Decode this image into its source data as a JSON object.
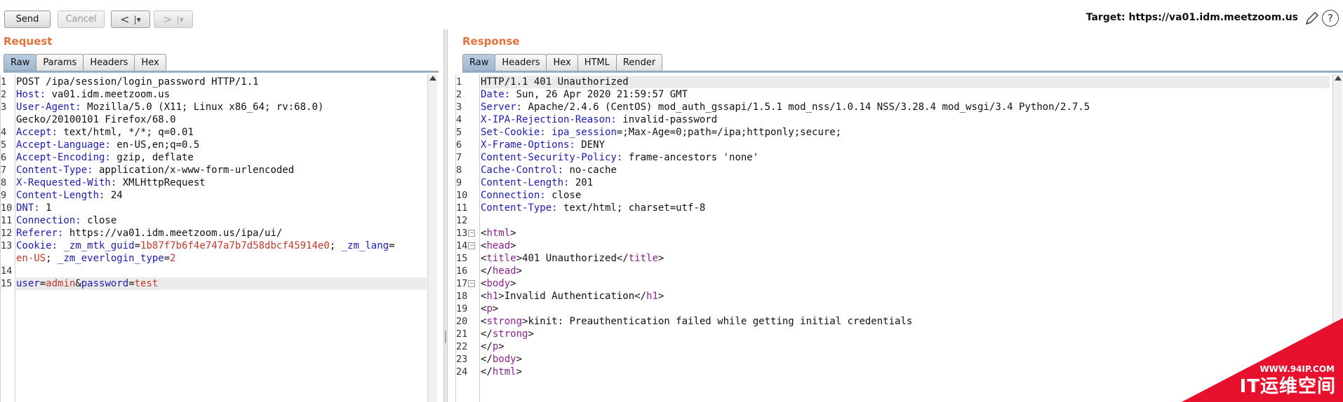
{
  "toolbar": {
    "send_label": "Send",
    "cancel_label": "Cancel",
    "back_label": "<",
    "forward_label": ">",
    "dropdown_glyph": "|▾",
    "target_text": "Target: https://va01.idm.meetzoom.us",
    "edit_icon": "pencil-icon",
    "help_label": "?"
  },
  "request": {
    "title": "Request",
    "tabs": [
      {
        "label": "Raw",
        "active": true
      },
      {
        "label": "Params",
        "active": false
      },
      {
        "label": "Headers",
        "active": false
      },
      {
        "label": "Hex",
        "active": false
      }
    ],
    "line_numbers": [
      "1",
      "2",
      "3",
      "",
      "4",
      "5",
      "6",
      "7",
      "8",
      "9",
      "10",
      "11",
      "12",
      "13",
      "",
      "14",
      "15"
    ],
    "lines": [
      {
        "type": "plain",
        "text": "POST /ipa/session/login_password HTTP/1.1"
      },
      {
        "type": "header",
        "name": "Host:",
        "value": " va01.idm.meetzoom.us"
      },
      {
        "type": "header",
        "name": "User-Agent:",
        "value": " Mozilla/5.0 (X11; Linux x86_64; rv:68.0)"
      },
      {
        "type": "plain",
        "text": "Gecko/20100101 Firefox/68.0"
      },
      {
        "type": "header",
        "name": "Accept:",
        "value": " text/html, */*; q=0.01"
      },
      {
        "type": "header",
        "name": "Accept-Language:",
        "value": " en-US,en;q=0.5"
      },
      {
        "type": "header",
        "name": "Accept-Encoding:",
        "value": " gzip, deflate"
      },
      {
        "type": "header",
        "name": "Content-Type:",
        "value": " application/x-www-form-urlencoded"
      },
      {
        "type": "header",
        "name": "X-Requested-With:",
        "value": " XMLHttpRequest"
      },
      {
        "type": "header",
        "name": "Content-Length:",
        "value": " 24"
      },
      {
        "type": "header",
        "name": "DNT:",
        "value": " 1"
      },
      {
        "type": "header",
        "name": "Connection:",
        "value": " close"
      },
      {
        "type": "header",
        "name": "Referer:",
        "value": " https://va01.idm.meetzoom.us/ipa/ui/"
      },
      {
        "type": "cookie1",
        "name": "Cookie:",
        "parts": [
          " ",
          "_zm_mtk_guid",
          "=",
          "1b87f7b6f4e747a7b7d58dbcf45914e0",
          "; ",
          "_zm_lang",
          "="
        ]
      },
      {
        "type": "cookie2",
        "parts": [
          "en-US",
          "; ",
          "_zm_everlogin_type",
          "=",
          "2"
        ]
      },
      {
        "type": "plain",
        "text": ""
      },
      {
        "type": "body",
        "parts": [
          "user",
          "=",
          "admin",
          "&",
          "password",
          "=",
          "test"
        ]
      }
    ]
  },
  "response": {
    "title": "Response",
    "tabs": [
      {
        "label": "Raw",
        "active": true
      },
      {
        "label": "Headers",
        "active": false
      },
      {
        "label": "Hex",
        "active": false
      },
      {
        "label": "HTML",
        "active": false
      },
      {
        "label": "Render",
        "active": false
      }
    ],
    "line_numbers": [
      "1",
      "2",
      "3",
      "4",
      "5",
      "6",
      "7",
      "8",
      "9",
      "10",
      "11",
      "12",
      "13",
      "14",
      "15",
      "16",
      "17",
      "18",
      "19",
      "20",
      "21",
      "22",
      "23",
      "24"
    ],
    "fold_lines": [
      "13",
      "14",
      "17"
    ],
    "lines": [
      {
        "type": "plain",
        "text": "HTTP/1.1 401 Unauthorized"
      },
      {
        "type": "header",
        "name": "Date:",
        "value": " Sun, 26 Apr 2020 21:59:57 GMT"
      },
      {
        "type": "header",
        "name": "Server:",
        "value": " Apache/2.4.6 (CentOS) mod_auth_gssapi/1.5.1 mod_nss/1.0.14 NSS/3.28.4 mod_wsgi/3.4 Python/2.7.5"
      },
      {
        "type": "header",
        "name": "X-IPA-Rejection-Reason:",
        "value": " invalid-password"
      },
      {
        "type": "setcookie",
        "name": "Set-Cookie:",
        "parts": [
          " ",
          "ipa_session",
          "=;Max-Age=0;path=/ipa;httponly;secure;"
        ]
      },
      {
        "type": "header",
        "name": "X-Frame-Options:",
        "value": " DENY"
      },
      {
        "type": "header",
        "name": "Content-Security-Policy:",
        "value": " frame-ancestors 'none'"
      },
      {
        "type": "header",
        "name": "Cache-Control:",
        "value": " no-cache"
      },
      {
        "type": "header",
        "name": "Content-Length:",
        "value": " 201"
      },
      {
        "type": "header",
        "name": "Connection:",
        "value": " close"
      },
      {
        "type": "header",
        "name": "Content-Type:",
        "value": " text/html; charset=utf-8"
      },
      {
        "type": "plain",
        "text": ""
      },
      {
        "type": "html",
        "parts": [
          [
            "p",
            "<"
          ],
          [
            "t",
            "html"
          ],
          [
            "p",
            ">"
          ]
        ]
      },
      {
        "type": "html",
        "parts": [
          [
            "p",
            "<"
          ],
          [
            "t",
            "head"
          ],
          [
            "p",
            ">"
          ]
        ]
      },
      {
        "type": "html",
        "parts": [
          [
            "p",
            "<"
          ],
          [
            "t",
            "title"
          ],
          [
            "p",
            ">401 Unauthorized</"
          ],
          [
            "t",
            "title"
          ],
          [
            "p",
            ">"
          ]
        ]
      },
      {
        "type": "html",
        "parts": [
          [
            "p",
            "</"
          ],
          [
            "t",
            "head"
          ],
          [
            "p",
            ">"
          ]
        ]
      },
      {
        "type": "html",
        "parts": [
          [
            "p",
            "<"
          ],
          [
            "t",
            "body"
          ],
          [
            "p",
            ">"
          ]
        ]
      },
      {
        "type": "html",
        "parts": [
          [
            "p",
            "<"
          ],
          [
            "t",
            "h1"
          ],
          [
            "p",
            ">Invalid Authentication</"
          ],
          [
            "t",
            "h1"
          ],
          [
            "p",
            ">"
          ]
        ]
      },
      {
        "type": "html",
        "parts": [
          [
            "p",
            "<"
          ],
          [
            "t",
            "p"
          ],
          [
            "p",
            ">"
          ]
        ]
      },
      {
        "type": "html",
        "parts": [
          [
            "p",
            "<"
          ],
          [
            "t",
            "strong"
          ],
          [
            "p",
            ">kinit: Preauthentication failed while getting initial credentials"
          ]
        ]
      },
      {
        "type": "html",
        "parts": [
          [
            "p",
            "</"
          ],
          [
            "t",
            "strong"
          ],
          [
            "p",
            ">"
          ]
        ]
      },
      {
        "type": "html",
        "parts": [
          [
            "p",
            "</"
          ],
          [
            "t",
            "p"
          ],
          [
            "p",
            ">"
          ]
        ]
      },
      {
        "type": "html",
        "parts": [
          [
            "p",
            "</"
          ],
          [
            "t",
            "body"
          ],
          [
            "p",
            ">"
          ]
        ]
      },
      {
        "type": "html",
        "parts": [
          [
            "p",
            "</"
          ],
          [
            "t",
            "html"
          ],
          [
            "p",
            ">"
          ]
        ]
      }
    ]
  },
  "watermark": {
    "url": "WWW.94IP.COM",
    "text": "IT运维空间",
    "color": "#e8112d"
  },
  "colors": {
    "accent_title": "#e4703a",
    "header_name": "#1b1bb4",
    "param_value": "#c0392b",
    "html_tag": "#8d1f8d"
  }
}
